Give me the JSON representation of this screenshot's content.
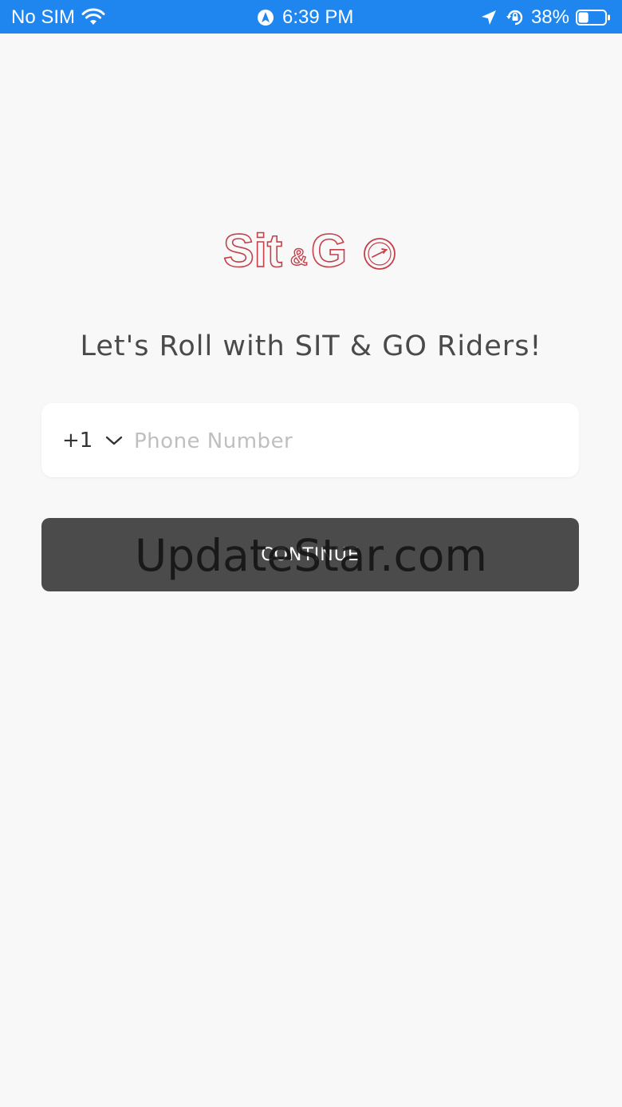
{
  "status_bar": {
    "carrier": "No SIM",
    "time": "6:39 PM",
    "battery": "38%",
    "battery_level": 0.38,
    "icons": [
      "wifi-icon",
      "navigation-app-icon",
      "location-arrow-icon",
      "rotation-lock-icon",
      "battery-icon"
    ]
  },
  "logo": {
    "text": "Sit&Go",
    "color": "#c4404a"
  },
  "headline": "Let's Roll with SIT & GO Riders!",
  "phone": {
    "country_code": "+1",
    "placeholder": "Phone Number",
    "value": ""
  },
  "continue_label": "CONTINUE",
  "watermark": "UpdateStar.com",
  "colors": {
    "status_bar": "#1f86ef",
    "background": "#f8f8f8",
    "button": "#4b4b4b",
    "brand": "#c4404a"
  }
}
